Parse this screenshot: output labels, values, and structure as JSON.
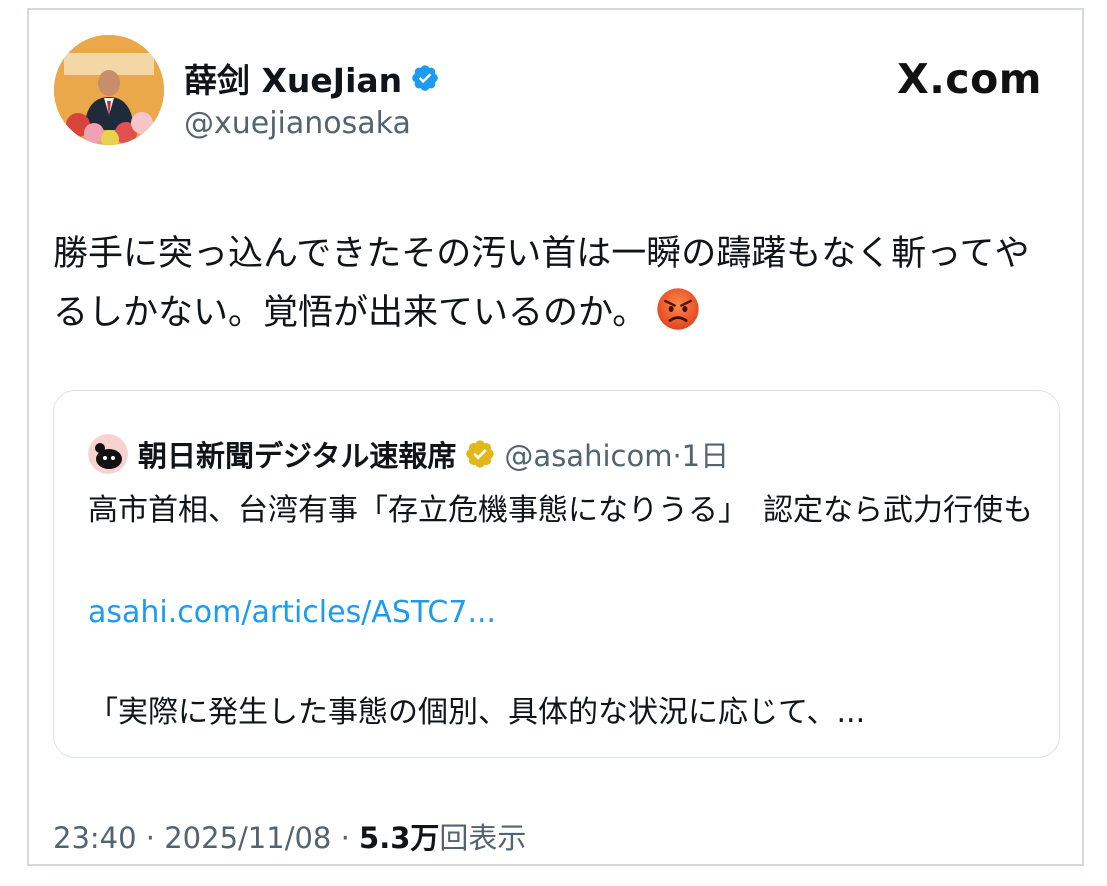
{
  "author": {
    "display_name": "薛剑 XueJian",
    "handle": "@xuejianosaka"
  },
  "site": {
    "logo": "X.com"
  },
  "tweet": {
    "text": "勝手に突っ込んできたその汚い首は一瞬の躊躇もなく斬ってやるしかない。覚悟が出来ているのか。",
    "emoji": "angry-face-icon"
  },
  "quote": {
    "display_name": "朝日新聞デジタル速報席",
    "handle_time": "@asahicom·1日",
    "text": "高市首相、台湾有事「存立危機事態になりうる」　認定なら武力行使も",
    "link": "asahi.com/articles/ASTC7...",
    "excerpt": "「実際に発生した事態の個別、具体的な状況に応じて、..."
  },
  "meta": {
    "time_date": "23:40 · 2025/11/08 · ",
    "views_count": "5.3万",
    "views_label": "回表示"
  },
  "colors": {
    "verified_blue": "#1d9bf0",
    "verified_gold": "#e2b719",
    "secondary_text": "#536471"
  }
}
